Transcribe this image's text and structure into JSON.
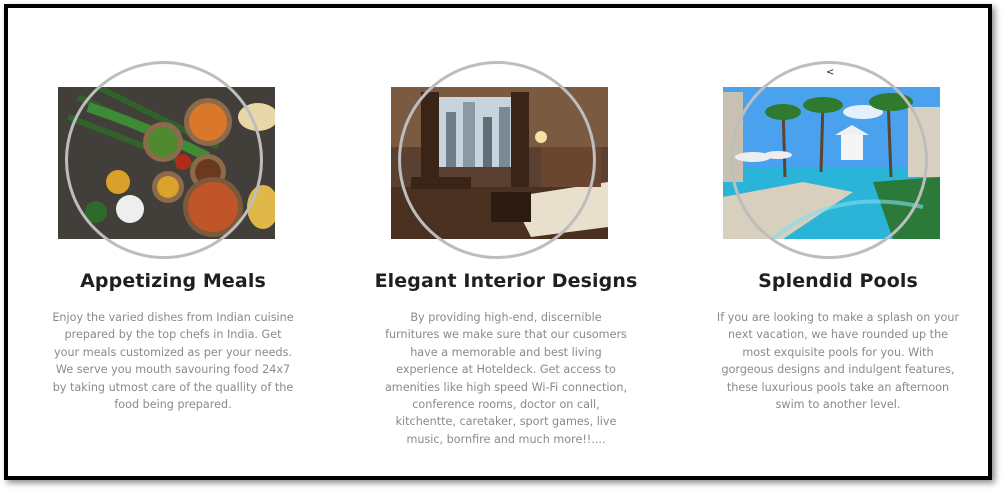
{
  "features": [
    {
      "title": "Appetizing Meals",
      "description": "Enjoy the varied dishes from Indian cuisine prepared by the top chefs in India. Get your meals customized as per your needs. We serve you mouth savouring food 24x7 by taking utmost care of the quallity of the food being prepared.",
      "image_icon": "food-platter-photo"
    },
    {
      "title": "Elegant Interior Designs",
      "description": "By providing high-end, discernible furnitures we make sure that our cusomers have a memorable and best living experience at Hoteldeck. Get access to amenities like high speed Wi-Fi connection, conference rooms, doctor on call, kitchentte, caretaker, sport games, live music, bornfire and much more!!....",
      "image_icon": "hotel-room-photo"
    },
    {
      "title": "Splendid Pools",
      "description": "If you are looking to make a splash on your next vacation, we have rounded up the most exquisite pools for you. With gorgeous designs and indulgent features, these luxurious pools take an afternoon swim to another level.",
      "image_icon": "resort-pool-photo"
    }
  ],
  "slider": {
    "prev_label": "<"
  },
  "colors": {
    "ring": "#bdbdbd",
    "title": "#1f1f1f",
    "text": "#8a8a8a",
    "frame": "#000000"
  }
}
